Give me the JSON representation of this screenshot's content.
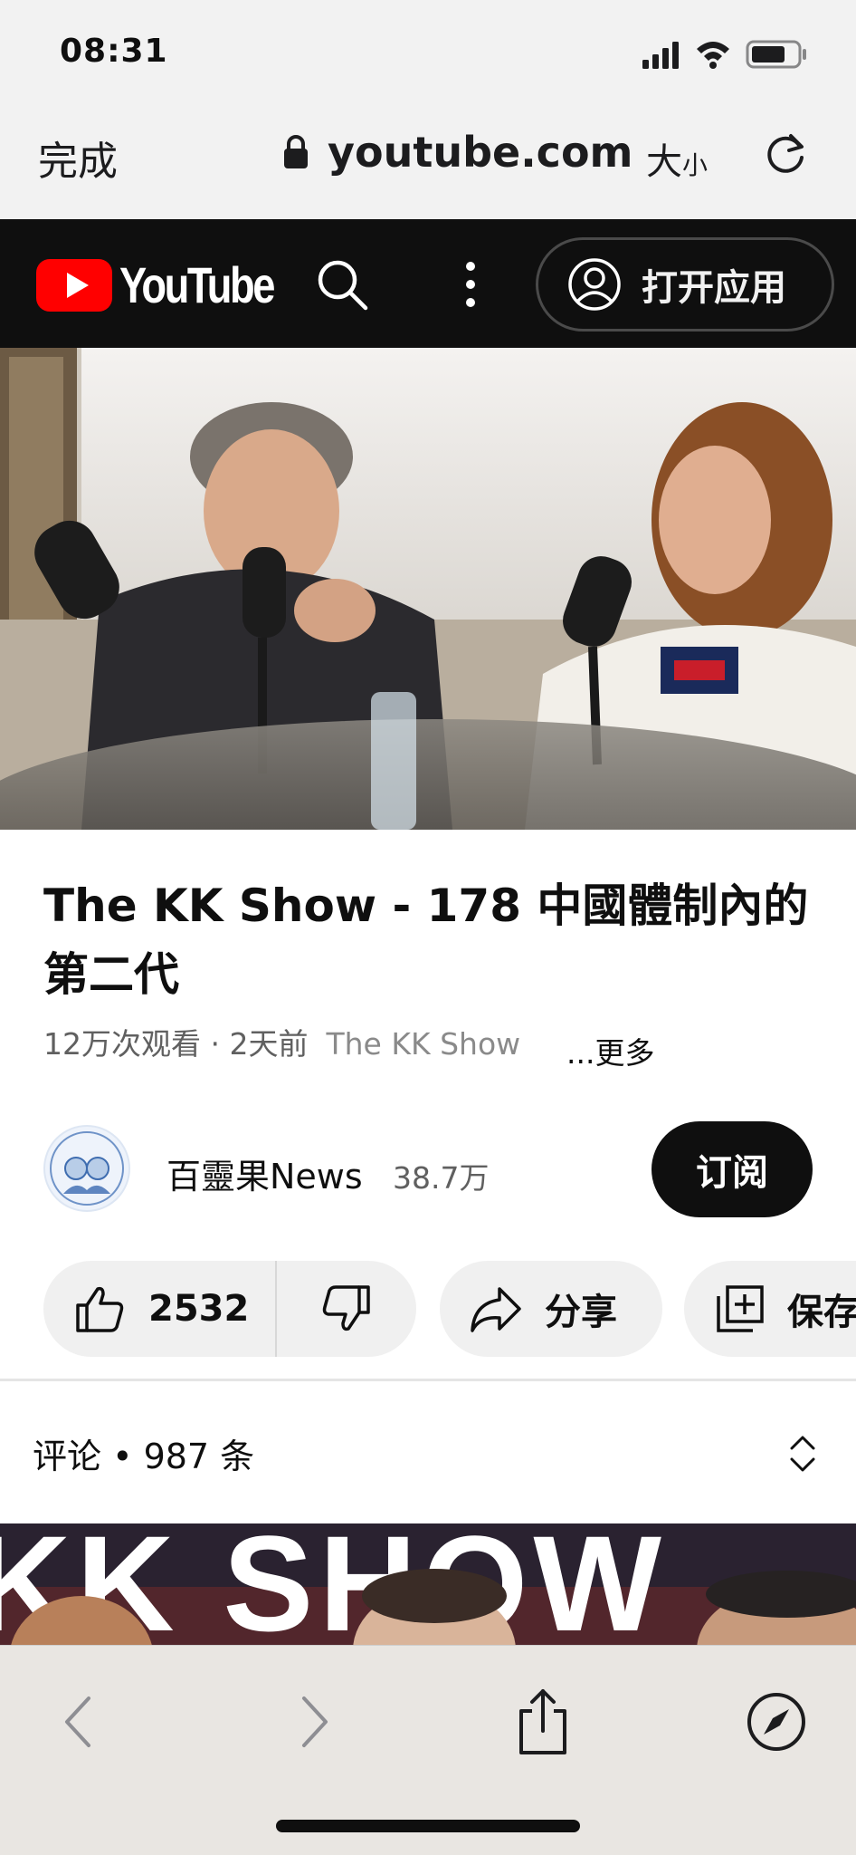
{
  "status_bar": {
    "time": "08:31"
  },
  "safari_top": {
    "done_label": "完成",
    "domain": "youtube.com",
    "text_size_big": "大",
    "text_size_small": "小"
  },
  "youtube_header": {
    "logo_text": "YouTube",
    "open_app_label": "打开应用"
  },
  "video": {
    "title": "The KK Show - 178 中國體制內的第二代",
    "views_and_age": "12万次观看 · 2天前",
    "channel_mention": "The KK Show",
    "more_label": "...更多"
  },
  "channel": {
    "name": "百靈果News",
    "subscribers": "38.7万",
    "subscribe_label": "订阅"
  },
  "actions": {
    "like_count": "2532",
    "share_label": "分享",
    "save_label": "保存"
  },
  "comments": {
    "label": "评论 • 987 条"
  },
  "next_video": {
    "banner_text": "KK SHOW"
  },
  "colors": {
    "youtube_red": "#ff0000",
    "header_bg": "#0f0f0f",
    "pill_bg": "#f0f0f0",
    "safari_bar_bg": "#f2f2f2"
  }
}
